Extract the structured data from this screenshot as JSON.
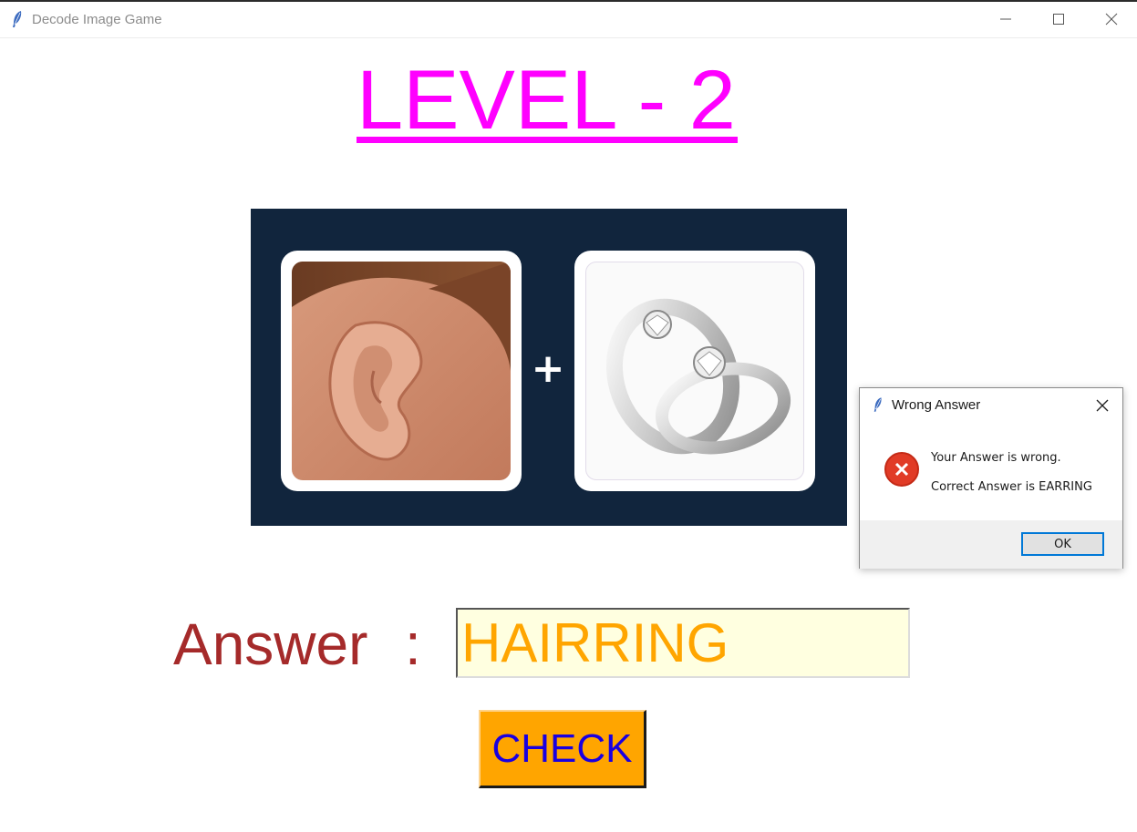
{
  "window": {
    "title": "Decode Image Game",
    "icon": "feather-icon"
  },
  "game": {
    "level_title": "LEVEL - 2",
    "plus_symbol": "+",
    "puzzle_images": [
      "ear-image",
      "rings-image"
    ],
    "answer_label": "Answer",
    "answer_colon": ":",
    "answer_value": "HAIRRING",
    "check_label": "CHECK"
  },
  "dialog": {
    "title": "Wrong Answer",
    "line1": "Your Answer is wrong.",
    "line2": "Correct Answer is EARRING",
    "ok_label": "OK",
    "icon": "error-icon"
  },
  "colors": {
    "title": "#ff00ff",
    "answer_label": "#a52a2a",
    "answer_text": "#ffa500",
    "input_bg": "#ffffe0",
    "check_bg": "#ffa500",
    "check_text": "#1a00e0",
    "puzzle_bg": "#11253d"
  }
}
